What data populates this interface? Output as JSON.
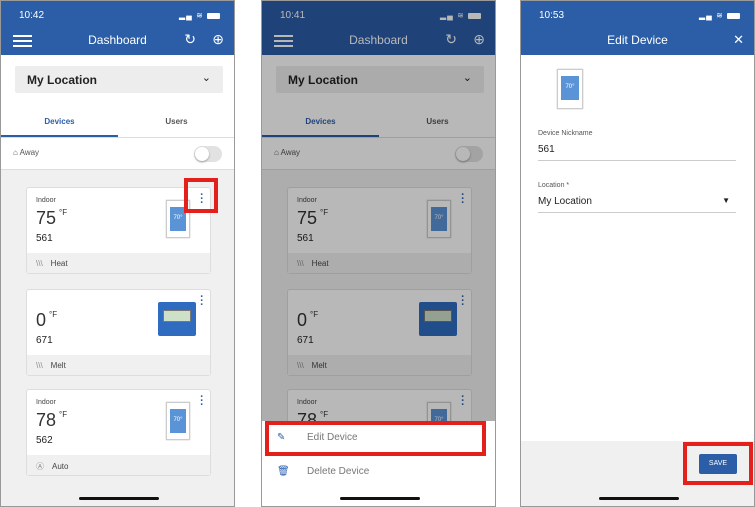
{
  "panels": [
    {
      "time": "10:42",
      "title": "Dashboard"
    },
    {
      "time": "10:41",
      "title": "Dashboard"
    },
    {
      "time": "10:53",
      "title": "Edit Device"
    }
  ],
  "location": "My Location",
  "tabs": [
    "Devices",
    "Users"
  ],
  "away_label": "Away",
  "devices": [
    {
      "label": "Indoor",
      "temp": "75",
      "unit": "°F",
      "name": "561",
      "mode": "Heat",
      "image": "thermostat"
    },
    {
      "label": "",
      "temp": "0",
      "unit": "°F",
      "name": "671",
      "mode": "Melt",
      "image": "snow-melt-controller"
    },
    {
      "label": "Indoor",
      "temp": "78",
      "unit": "°F",
      "name": "562",
      "mode": "Auto",
      "image": "thermostat"
    }
  ],
  "thermostat_screen": "70°",
  "sheet": {
    "edit": "Edit Device",
    "delete": "Delete Device"
  },
  "edit": {
    "nickname_label": "Device Nickname",
    "nickname": "561",
    "location_label": "Location *",
    "location": "My Location",
    "save": "SAVE"
  },
  "colors": {
    "brand": "#2c5ea8",
    "highlight": "#e3201c"
  }
}
